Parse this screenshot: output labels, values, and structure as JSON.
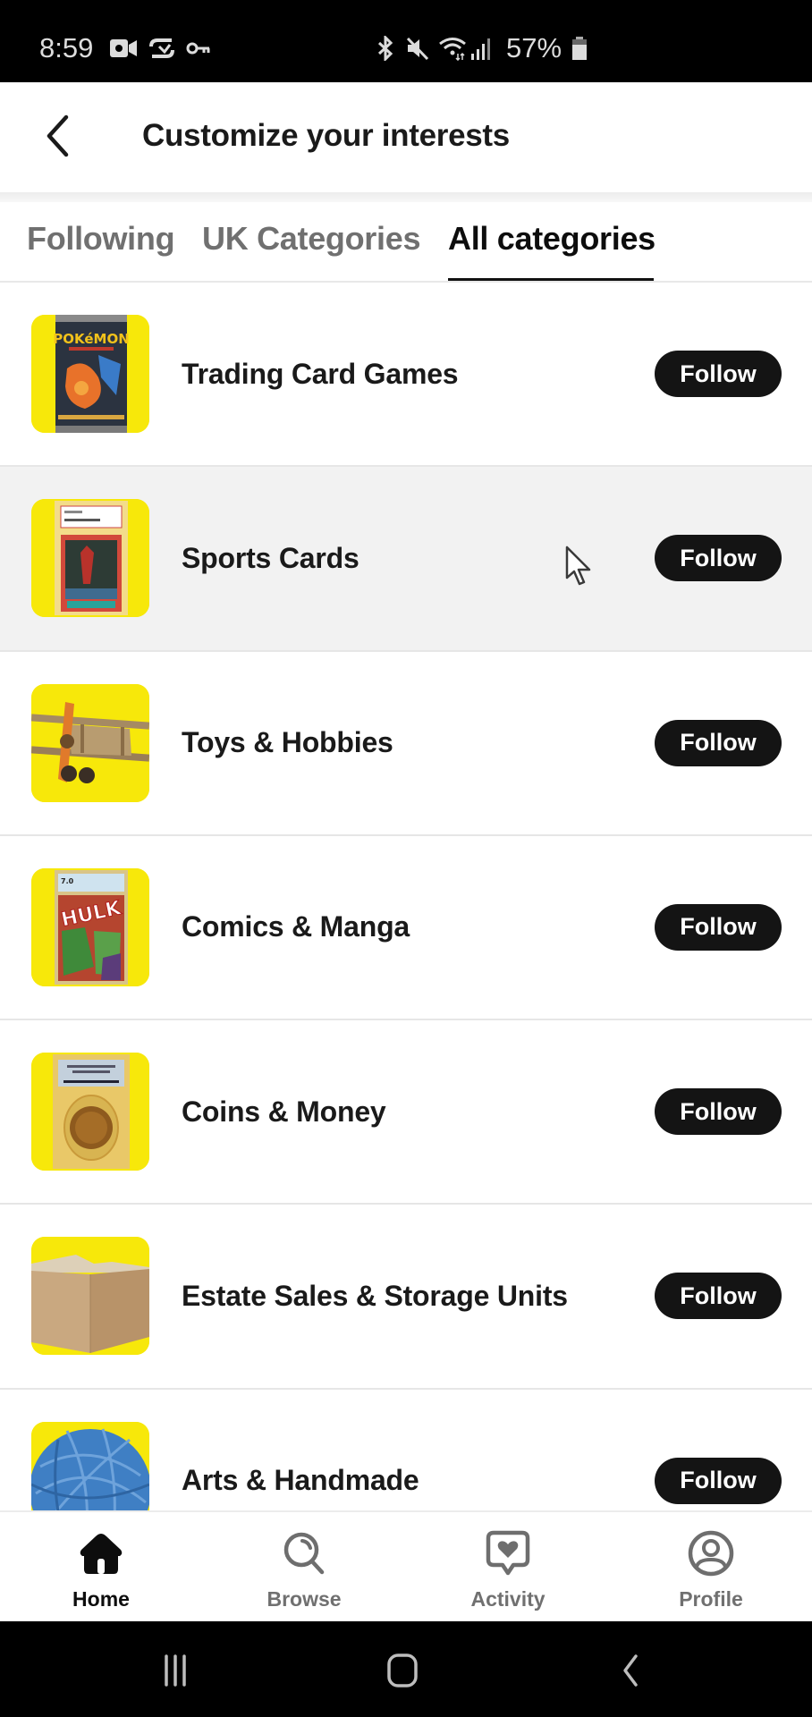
{
  "status_bar": {
    "time": "8:59",
    "battery_percent": "57%",
    "left_icons": [
      "video-camera-icon",
      "cast-icon",
      "vpn-key-icon"
    ],
    "right_icons": [
      "bluetooth-icon",
      "mute-icon",
      "wifi-icon",
      "signal-icon",
      "battery-icon"
    ]
  },
  "header": {
    "back_icon": "chevron-left-icon",
    "title": "Customize your interests"
  },
  "tabs": [
    {
      "label": "Following",
      "active": false
    },
    {
      "label": "UK Categories",
      "active": false
    },
    {
      "label": "All categories",
      "active": true
    }
  ],
  "categories": [
    {
      "name": "Trading Card Games",
      "thumbnail": "pokemon-booster-pack",
      "button": "Follow"
    },
    {
      "name": "Sports Cards",
      "thumbnail": "graded-basketball-card",
      "button": "Follow",
      "hovered": true
    },
    {
      "name": "Toys & Hobbies",
      "thumbnail": "wooden-toy-airplane",
      "button": "Follow"
    },
    {
      "name": "Comics & Manga",
      "thumbnail": "graded-hulk-comic",
      "button": "Follow"
    },
    {
      "name": "Coins & Money",
      "thumbnail": "graded-gold-coin",
      "button": "Follow"
    },
    {
      "name": "Estate Sales & Storage Units",
      "thumbnail": "cardboard-box",
      "button": "Follow"
    },
    {
      "name": "Arts & Handmade",
      "thumbnail": "blue-yarn-ball",
      "button": "Follow"
    }
  ],
  "bottom_nav": [
    {
      "label": "Home",
      "icon": "home-icon",
      "active": true
    },
    {
      "label": "Browse",
      "icon": "search-icon",
      "active": false
    },
    {
      "label": "Activity",
      "icon": "heart-message-icon",
      "active": false
    },
    {
      "label": "Profile",
      "icon": "profile-icon",
      "active": false
    }
  ],
  "system_nav": [
    "recents-icon",
    "home-circle-icon",
    "back-icon"
  ],
  "colors": {
    "thumbnail_bg": "#F7E80A",
    "follow_button_bg": "#141414",
    "active_text": "#0D0D0D",
    "inactive_text": "#707070",
    "hover_row_bg": "#F2F2F2"
  }
}
